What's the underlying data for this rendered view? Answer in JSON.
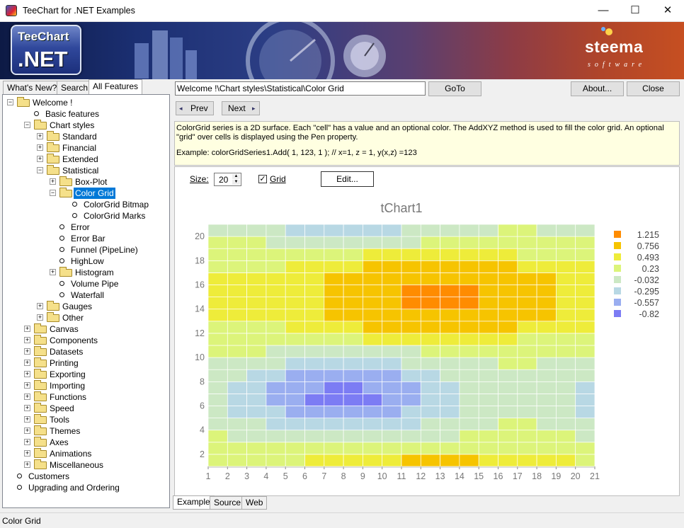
{
  "window": {
    "title": "TeeChart for .NET Examples",
    "minimize": "—",
    "maximize": "☐",
    "close": "✕"
  },
  "banner": {
    "logo_top": "TeeChart",
    "logo_bottom": ".NET",
    "brand": "steema",
    "brand_sub": "software"
  },
  "left_tabs": [
    "What's New?",
    "Search",
    "All Features"
  ],
  "tree": [
    {
      "label": "Welcome !",
      "level": 0,
      "type": "folder",
      "state": "-"
    },
    {
      "label": "Basic features",
      "level": 1,
      "type": "leaf"
    },
    {
      "label": "Chart styles",
      "level": 1,
      "type": "folder",
      "state": "-"
    },
    {
      "label": "Standard",
      "level": 2,
      "type": "folder",
      "state": "+"
    },
    {
      "label": "Financial",
      "level": 2,
      "type": "folder",
      "state": "+"
    },
    {
      "label": "Extended",
      "level": 2,
      "type": "folder",
      "state": "+"
    },
    {
      "label": "Statistical",
      "level": 2,
      "type": "folder",
      "state": "-"
    },
    {
      "label": "Box-Plot",
      "level": 3,
      "type": "folder",
      "state": "+"
    },
    {
      "label": "Color Grid",
      "level": 3,
      "type": "folder",
      "state": "-",
      "selected": true
    },
    {
      "label": "ColorGrid Bitmap",
      "level": 4,
      "type": "leaf"
    },
    {
      "label": "ColorGrid Marks",
      "level": 4,
      "type": "leaf"
    },
    {
      "label": "Error",
      "level": 3,
      "type": "leaf"
    },
    {
      "label": "Error Bar",
      "level": 3,
      "type": "leaf"
    },
    {
      "label": "Funnel (PipeLine)",
      "level": 3,
      "type": "leaf"
    },
    {
      "label": "HighLow",
      "level": 3,
      "type": "leaf"
    },
    {
      "label": "Histogram",
      "level": 3,
      "type": "folder",
      "state": "+"
    },
    {
      "label": "Volume Pipe",
      "level": 3,
      "type": "leaf"
    },
    {
      "label": "Waterfall",
      "level": 3,
      "type": "leaf"
    },
    {
      "label": "Gauges",
      "level": 2,
      "type": "folder",
      "state": "+"
    },
    {
      "label": "Other",
      "level": 2,
      "type": "folder",
      "state": "+"
    },
    {
      "label": "Canvas",
      "level": 1,
      "type": "folder",
      "state": "+"
    },
    {
      "label": "Components",
      "level": 1,
      "type": "folder",
      "state": "+"
    },
    {
      "label": "Datasets",
      "level": 1,
      "type": "folder",
      "state": "+"
    },
    {
      "label": "Printing",
      "level": 1,
      "type": "folder",
      "state": "+"
    },
    {
      "label": "Exporting",
      "level": 1,
      "type": "folder",
      "state": "+"
    },
    {
      "label": "Importing",
      "level": 1,
      "type": "folder",
      "state": "+"
    },
    {
      "label": "Functions",
      "level": 1,
      "type": "folder",
      "state": "+"
    },
    {
      "label": "Speed",
      "level": 1,
      "type": "folder",
      "state": "+"
    },
    {
      "label": "Tools",
      "level": 1,
      "type": "folder",
      "state": "+"
    },
    {
      "label": "Themes",
      "level": 1,
      "type": "folder",
      "state": "+"
    },
    {
      "label": "Axes",
      "level": 1,
      "type": "folder",
      "state": "+"
    },
    {
      "label": "Animations",
      "level": 1,
      "type": "folder",
      "state": "+"
    },
    {
      "label": "Miscellaneous",
      "level": 1,
      "type": "folder",
      "state": "+"
    },
    {
      "label": "Customers",
      "level": 0,
      "type": "leaf"
    },
    {
      "label": "Upgrading and Ordering",
      "level": 0,
      "type": "leaf"
    }
  ],
  "toolbar": {
    "path": "Welcome !\\Chart styles\\Statistical\\Color Grid",
    "goto": "GoTo",
    "about": "About...",
    "close": "Close",
    "prev": "Prev",
    "next": "Next"
  },
  "description": {
    "line1": "ColorGrid series is a 2D surface. Each \"cell\" has a value and an optional color. The AddXYZ method is used to fill the color grid. An optional \"grid\" over cells is displayed using the Pen property.",
    "line2": "Example: colorGridSeries1.Add( 1, 123, 1 ); // x=1, z = 1, y(x,z) =123"
  },
  "controls": {
    "size_label": "Size:",
    "size_value": "20",
    "grid_label": "Grid",
    "grid_checked": true,
    "edit": "Edit..."
  },
  "bottom_tabs": [
    "Example",
    "Source",
    "Web"
  ],
  "status": "Color Grid",
  "chart_data": {
    "type": "heatmap",
    "title": "tChart1",
    "x_ticks": [
      1,
      2,
      3,
      4,
      5,
      6,
      7,
      8,
      9,
      10,
      11,
      12,
      13,
      14,
      15,
      16,
      17,
      18,
      19,
      20,
      21
    ],
    "y_ticks": [
      2,
      4,
      6,
      8,
      10,
      12,
      14,
      16,
      18,
      20
    ],
    "xlim": [
      1,
      21
    ],
    "ylim": [
      1,
      21
    ],
    "grid": true,
    "legend_position": "right",
    "legend": [
      {
        "label": "1.215",
        "color": "#ff8c00"
      },
      {
        "label": "0.756",
        "color": "#f6c400"
      },
      {
        "label": "0.493",
        "color": "#eeec3a"
      },
      {
        "label": "0.23",
        "color": "#dcf47a"
      },
      {
        "label": "-0.032",
        "color": "#cce8c4"
      },
      {
        "label": "-0.295",
        "color": "#b8d8e4"
      },
      {
        "label": "-0.557",
        "color": "#9aaef0"
      },
      {
        "label": "-0.82",
        "color": "#7c7cf4"
      }
    ],
    "cells_description": "20x20 grid, values approximated as cos-based surface",
    "value_range": [
      -0.82,
      1.215
    ]
  }
}
